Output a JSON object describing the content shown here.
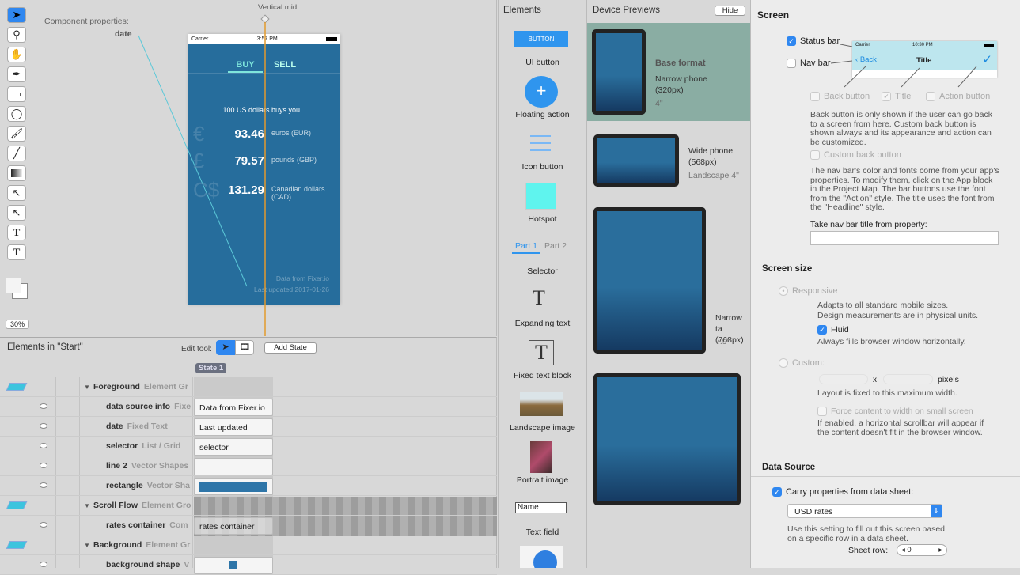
{
  "canvas": {
    "component_properties_label": "Component properties:",
    "component_name": "date",
    "guide_label": "Vertical mid",
    "zoom": "30%"
  },
  "phone": {
    "carrier": "Carrier",
    "time": "3:57 PM",
    "tabs": [
      "BUY",
      "SELL"
    ],
    "headline": "100 US dollars buys you...",
    "rates": [
      {
        "symbol": "€",
        "value": "93.46",
        "currency": "euros (EUR)"
      },
      {
        "symbol": "£",
        "value": "79.57",
        "currency": "pounds (GBP)"
      },
      {
        "symbol": "C$",
        "value": "131.29",
        "currency": "Canadian dollars (CAD)"
      }
    ],
    "source": "Data from Fixer.io",
    "updated": "Last updated 2017-01-26"
  },
  "elements_panel": {
    "title": "Elements in \"Start\"",
    "edit_tool_label": "Edit tool:",
    "add_state": "Add State",
    "state": "State 1",
    "rows": [
      {
        "name": "Foreground",
        "type": "Element Gr",
        "state": ""
      },
      {
        "name": "data source info",
        "type": "Fixe",
        "state": "Data from Fixer.io"
      },
      {
        "name": "date",
        "type": "Fixed Text",
        "state": "Last updated"
      },
      {
        "name": "selector",
        "type": "List / Grid",
        "state": "selector"
      },
      {
        "name": "line 2",
        "type": "Vector Shapes",
        "state": ""
      },
      {
        "name": "rectangle",
        "type": "Vector Sha",
        "state": ""
      },
      {
        "name": "Scroll Flow",
        "type": "Element Gro",
        "state": ""
      },
      {
        "name": "rates container",
        "type": "Com",
        "state": "rates container"
      },
      {
        "name": "Background",
        "type": "Element Gr",
        "state": ""
      },
      {
        "name": "background shape",
        "type": "V",
        "state": ""
      }
    ]
  },
  "library": {
    "title": "Elements",
    "button_text": "BUTTON",
    "items": [
      "UI button",
      "Floating action",
      "Icon button",
      "Hotspot",
      "Selector",
      "Expanding text",
      "Fixed text block",
      "Landscape image",
      "Portrait image",
      "Text field"
    ],
    "selector_parts": [
      "Part 1",
      "Part 2"
    ],
    "text_field_value": "Name"
  },
  "devices": {
    "title": "Device Previews",
    "hide": "Hide",
    "base_label": "Base format",
    "items": [
      {
        "name": "Narrow phone (320px)",
        "size": "4\""
      },
      {
        "name": "Wide phone (568px)",
        "size": "Landscape 4\""
      },
      {
        "name": "Narrow ta (768px)",
        "size": "7.9\""
      }
    ]
  },
  "screen": {
    "title": "Screen",
    "status_bar": "Status bar",
    "nav_bar": "Nav bar",
    "preview_carrier": "Carrier",
    "preview_time": "10:30 PM",
    "preview_back": "Back",
    "preview_title": "Title",
    "back_button": "Back button",
    "title_opt": "Title",
    "action_button": "Action button",
    "back_help": "Back button is only shown if the user can go back to a screen from here. Custom back button is shown always and its appearance and action can be customized.",
    "custom_back": "Custom back button",
    "nav_help": "The nav bar's color and fonts come from your app's properties. To modify them, click on the App block in the Project Map. The bar buttons use the font from the \"Action\" style. The title uses the font from the \"Headline\" style.",
    "title_prop_label": "Take nav bar title from property:",
    "title_prop_value": ""
  },
  "screen_size": {
    "title": "Screen size",
    "responsive": "Responsive",
    "responsive_help": "Adapts to all standard mobile sizes.\nDesign measurements are in physical units.",
    "fluid": "Fluid",
    "fluid_help": "Always fills browser window horizontally.",
    "custom": "Custom:",
    "x": "x",
    "pixels": "pixels",
    "custom_help": "Layout is fixed to this maximum width.",
    "force": "Force content to width on small screen",
    "force_help": "If enabled, a horizontal scrollbar will appear if the content doesn't fit in the browser window."
  },
  "data_source": {
    "title": "Data Source",
    "carry": "Carry properties from data sheet:",
    "sheet": "USD rates",
    "help": "Use this setting to fill out this screen based on a specific row in a data sheet.",
    "row_label": "Sheet row:",
    "row_value": "0"
  }
}
